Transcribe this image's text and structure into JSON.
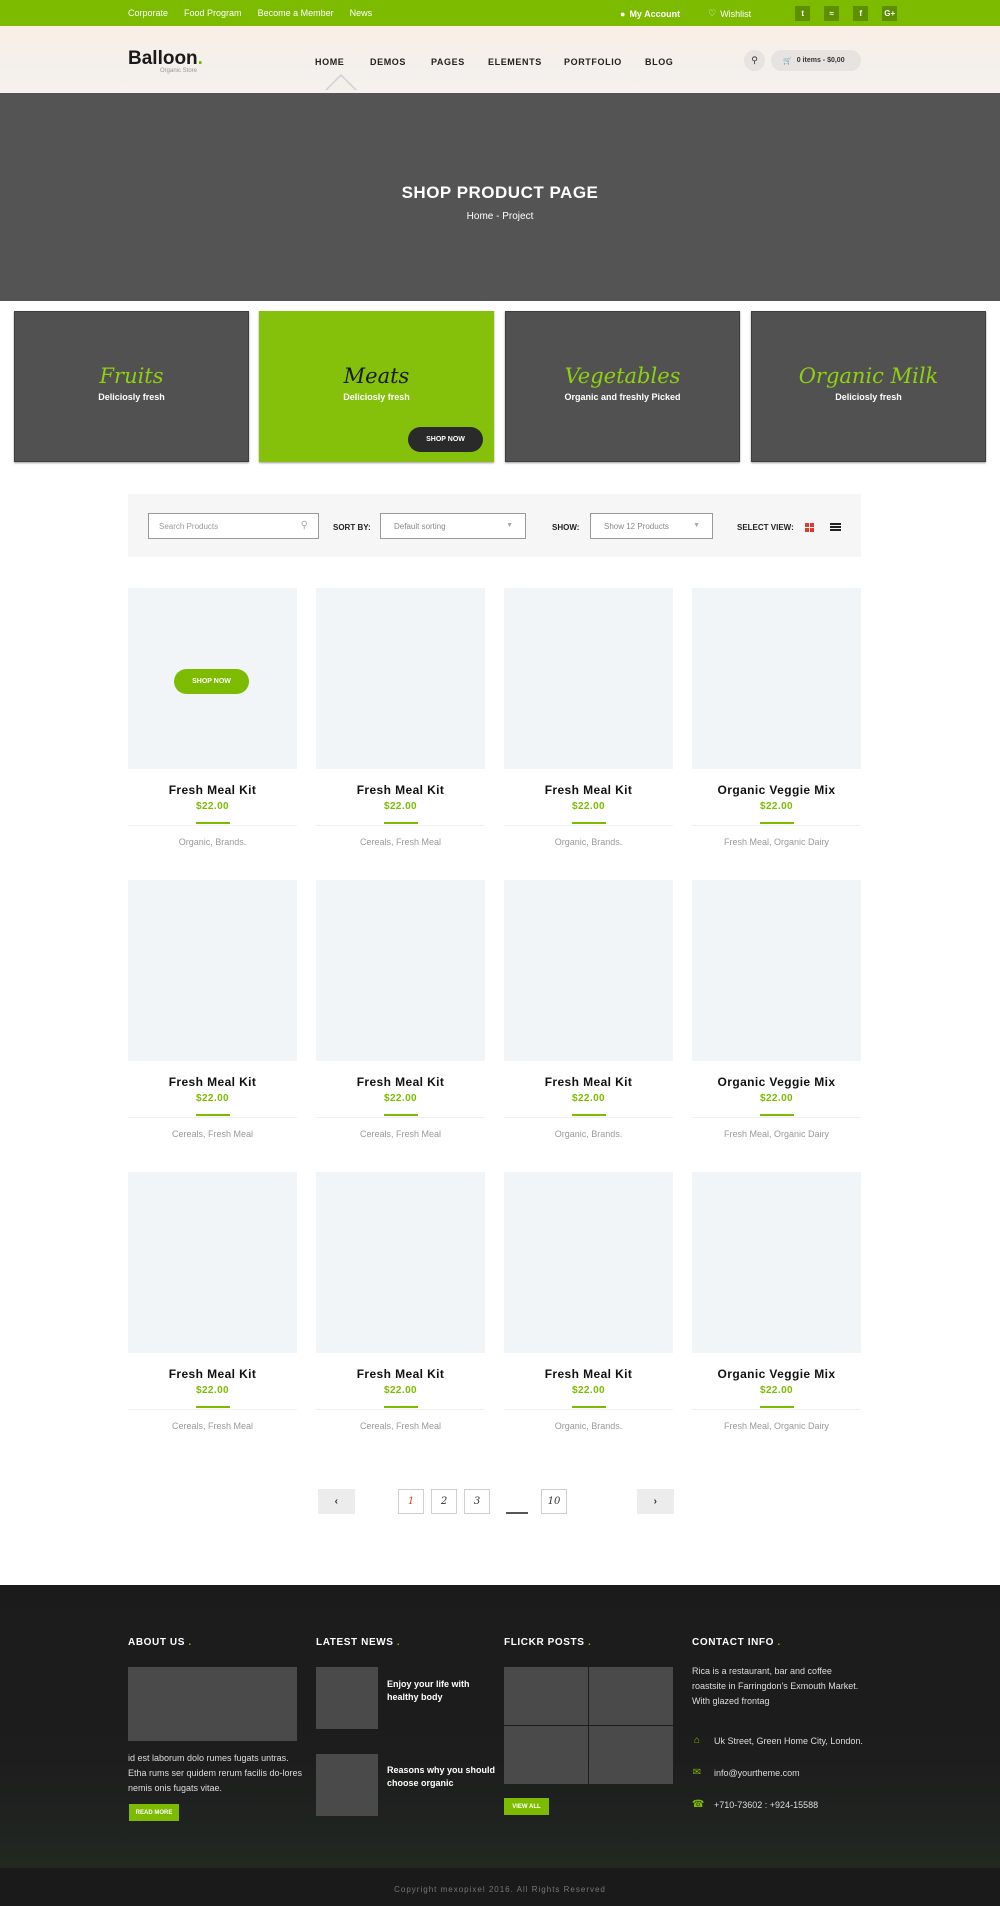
{
  "topbar": {
    "links": [
      "Corporate",
      "Food Program",
      "Become a Member",
      "News"
    ],
    "account": "My Account",
    "wishlist": "Wishlist",
    "social": [
      "t",
      "rss",
      "f",
      "G+"
    ]
  },
  "header": {
    "logo": "Balloon",
    "logo_dot": ".",
    "logo_sub": "Organic Store",
    "nav": [
      "HOME",
      "DEMOS",
      "PAGES",
      "ELEMENTS",
      "PORTFOLIO",
      "BLOG"
    ],
    "cart": "0 items - $0,00"
  },
  "hero": {
    "title": "SHOP PRODUCT PAGE",
    "breadcrumb": "Home - Project"
  },
  "categories": [
    {
      "title": "Fruits",
      "sub": "Deliciosly fresh"
    },
    {
      "title": "Meats",
      "sub": "Deliciosly fresh",
      "button": "SHOP NOW"
    },
    {
      "title": "Vegetables",
      "sub": "Organic and freshly Picked"
    },
    {
      "title": "Organic Milk",
      "sub": "Deliciosly fresh"
    }
  ],
  "toolbar": {
    "search_placeholder": "Search Products",
    "sort_label": "SORT BY:",
    "sort_value": "Default sorting",
    "show_label": "SHOW:",
    "show_value": "Show 12 Products",
    "view_label": "SELECT VIEW:"
  },
  "products": [
    {
      "name": "Fresh Meal Kit",
      "price": "$22.00",
      "tags": "Organic,  Brands.",
      "button": "SHOP NOW"
    },
    {
      "name": "Fresh Meal Kit",
      "price": "$22.00",
      "tags": "Cereals, Fresh Meal"
    },
    {
      "name": "Fresh Meal Kit",
      "price": "$22.00",
      "tags": "Organic,  Brands."
    },
    {
      "name": "Organic Veggie Mix",
      "price": "$22.00",
      "tags": "Fresh Meal,  Organic Dairy"
    },
    {
      "name": "Fresh Meal Kit",
      "price": "$22.00",
      "tags": "Cereals, Fresh Meal"
    },
    {
      "name": "Fresh Meal Kit",
      "price": "$22.00",
      "tags": "Cereals, Fresh Meal"
    },
    {
      "name": "Fresh Meal Kit",
      "price": "$22.00",
      "tags": "Organic,  Brands."
    },
    {
      "name": "Organic Veggie Mix",
      "price": "$22.00",
      "tags": "Fresh Meal,  Organic Dairy"
    },
    {
      "name": "Fresh Meal Kit",
      "price": "$22.00",
      "tags": "Cereals, Fresh Meal"
    },
    {
      "name": "Fresh Meal Kit",
      "price": "$22.00",
      "tags": "Cereals, Fresh Meal"
    },
    {
      "name": "Fresh Meal Kit",
      "price": "$22.00",
      "tags": "Organic,  Brands."
    },
    {
      "name": "Organic Veggie Mix",
      "price": "$22.00",
      "tags": "Fresh Meal,  Organic Dairy"
    }
  ],
  "pagination": {
    "prev": "‹",
    "pages": [
      "1",
      "2",
      "3",
      "10"
    ],
    "next": "›"
  },
  "footer": {
    "about_title": "ABOUT US",
    "about_text": "id est laborum dolo rumes fugats untras. Etha rums ser quidem rerum facilis do-lores nemis onis fugats vitae.",
    "about_button": "READ MORE",
    "news_title": "LATEST NEWS",
    "news": [
      "Enjoy your life with healthy body",
      "Reasons why you should choose organic"
    ],
    "flickr_title": "FLICKR POSTS",
    "flickr_button": "VIEW ALL",
    "contact_title": "CONTACT INFO",
    "contact_text": "Rica is a restaurant, bar and coffee roastsite in Farringdon's Exmouth Market. With glazed frontag",
    "address": "Uk Street, Green Home City, London.",
    "email": "info@yourtheme.com",
    "phone": "+710-73602 : +924-15588",
    "dot": ".",
    "copyright": "Copyright mexopixel 2016. All Rights Reserved"
  },
  "colors": {
    "accent": "#7dbb00",
    "dark": "#1b1b1b",
    "hero": "#545454",
    "active_page": "#e23b2e"
  }
}
